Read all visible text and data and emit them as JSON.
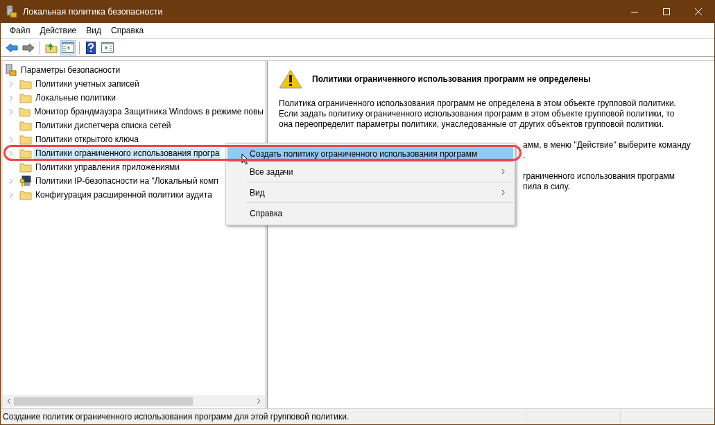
{
  "window": {
    "title": "Локальная политика безопасности"
  },
  "menu": [
    "Файл",
    "Действие",
    "Вид",
    "Справка"
  ],
  "toolbar": [
    {
      "kind": "back",
      "selected": false
    },
    {
      "kind": "forward",
      "selected": false
    },
    {
      "kind": "up",
      "selected": false
    },
    {
      "kind": "tree",
      "selected": true
    },
    {
      "kind": "help",
      "selected": false
    },
    {
      "kind": "pane",
      "selected": false
    }
  ],
  "tree": {
    "label": "Параметры безопасности",
    "children": [
      {
        "label": "Политики учетных записей",
        "kind": "folder",
        "expandable": true,
        "selected": false
      },
      {
        "label": "Локальные политики",
        "kind": "folder",
        "expandable": true,
        "selected": false
      },
      {
        "label": "Монитор брандмауэра Защитника Windows в режиме повы",
        "kind": "folder",
        "expandable": true,
        "selected": false
      },
      {
        "label": "Политики диспетчера списка сетей",
        "kind": "folder",
        "expandable": false,
        "selected": false
      },
      {
        "label": "Политики открытого ключа",
        "kind": "folder",
        "expandable": true,
        "selected": false
      },
      {
        "label": "Политики ограниченного использования програ",
        "kind": "folder",
        "expandable": true,
        "selected": true
      },
      {
        "label": "Политики управления приложениями",
        "kind": "folder",
        "expandable": false,
        "selected": false
      },
      {
        "label": "Политики IP-безопасности на \"Локальный комп",
        "kind": "ip",
        "expandable": true,
        "selected": false
      },
      {
        "label": "Конфигурация расширенной политики аудита",
        "kind": "folder",
        "expandable": true,
        "selected": false
      }
    ]
  },
  "details": {
    "heading": "Политики ограниченного использования программ не определены",
    "paragraphs": [
      {
        "covered": false,
        "lines": [
          "Политика ограниченного использования программ не определена в этом объекте групповой политики.",
          "Если задать политику ограниченного использования программ в этом объекте групповой политики, то",
          "она переопределит параметры политики, унаследованные от других объектов групповой политики."
        ]
      },
      {
        "covered": true,
        "lines": [
          "амм, в меню \"Действие\" выберите команду",
          "."
        ]
      },
      {
        "covered": true,
        "lines": [
          "граниченного использования программ",
          "пила в силу."
        ]
      }
    ]
  },
  "context_menu": [
    {
      "kind": "item",
      "label": "Создать политику ограниченного использования программ",
      "selected": true,
      "submenu": false
    },
    {
      "kind": "item",
      "label": "Все задачи",
      "selected": false,
      "submenu": true
    },
    {
      "kind": "separator"
    },
    {
      "kind": "item",
      "label": "Вид",
      "selected": false,
      "submenu": true
    },
    {
      "kind": "separator"
    },
    {
      "kind": "item",
      "label": "Справка",
      "selected": false,
      "submenu": false
    }
  ],
  "status_bar": "Создание политик ограниченного использования программ для этой групповой политики."
}
